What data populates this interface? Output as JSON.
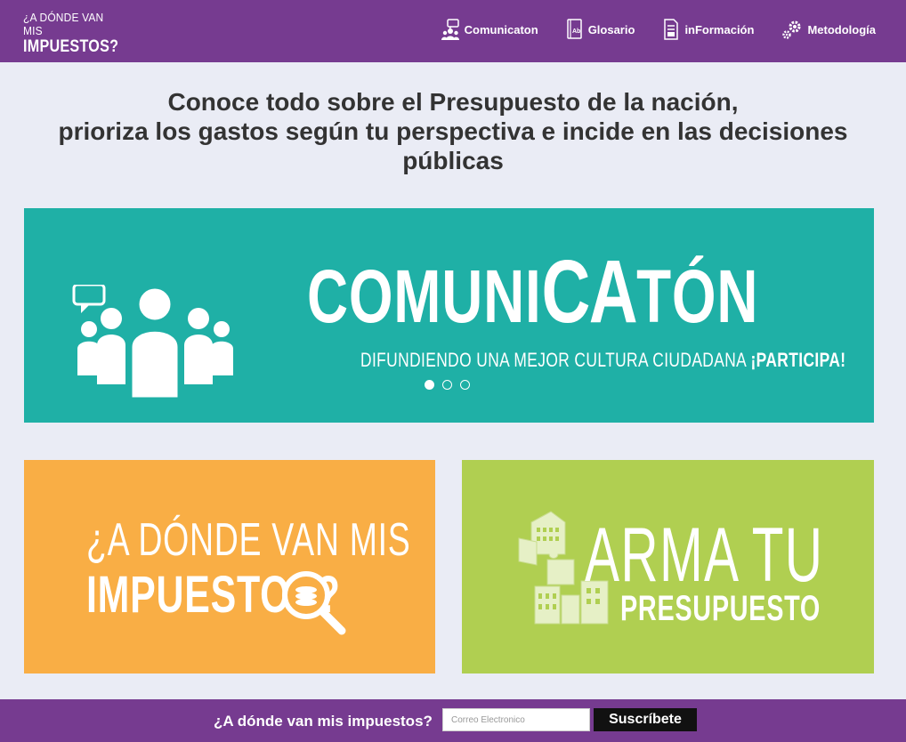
{
  "logo": {
    "line1": "¿A DÓNDE VAN MIS",
    "line2": "IMPUESTOS?"
  },
  "nav": {
    "items": [
      {
        "label": "Comunicaton",
        "icon": "people-chat-icon"
      },
      {
        "label": "Glosario",
        "icon": "book-ab-icon"
      },
      {
        "label": "inFormación",
        "icon": "document-icon"
      },
      {
        "label": "Metodología",
        "icon": "gears-icon"
      }
    ]
  },
  "headline": {
    "line1": "Conoce todo sobre el Presupuesto de la nación,",
    "line2": "prioriza los gastos según tu perspectiva e incide en las decisiones",
    "line3": "públicas"
  },
  "banner": {
    "title_part1": "COMUNI",
    "title_part2": "CA",
    "title_part3": "TÓN",
    "subtitle": "DIFUNDIENDO UNA MEJOR CULTURA CIUDADANA ",
    "subtitle_emphasis": "¡PARTICIPA!",
    "slides_total": 3,
    "active_slide": 1
  },
  "tiles": {
    "impuestos": {
      "line1": "¿A DÓNDE VAN MIS",
      "line2": "IMPUESTOS?"
    },
    "arma": {
      "line1": "ARMA TU",
      "line2": "PRESUPUESTO"
    }
  },
  "footer": {
    "label": "¿A dónde van mis impuestos?",
    "email_placeholder": "Correo Electronico",
    "email_value": "",
    "subscribe_label": "Suscríbete"
  },
  "colors": {
    "header_purple": "#763b90",
    "page_bg": "#eaecf5",
    "banner_teal": "#1fb0a6",
    "tile_orange": "#f9ae45",
    "tile_green": "#b0cf51",
    "button_black": "#111111"
  }
}
